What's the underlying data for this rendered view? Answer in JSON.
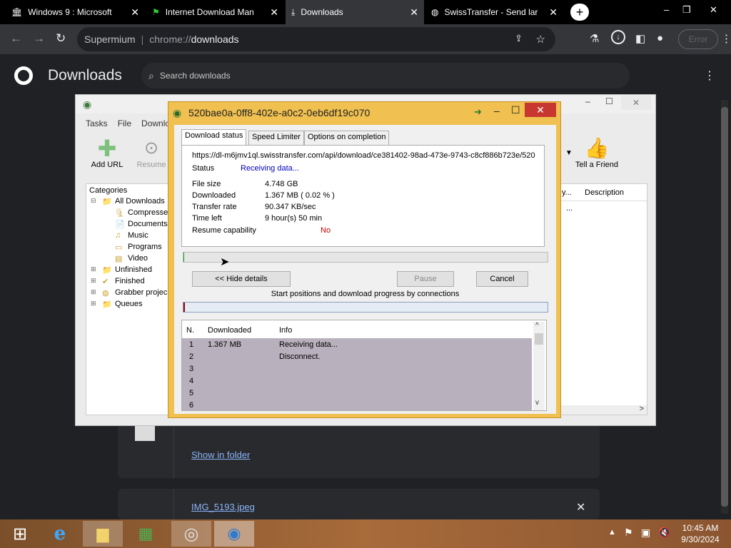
{
  "browser": {
    "tabs": [
      {
        "title": "Windows 9 : Microsoft",
        "icon": "library-icon",
        "active": false
      },
      {
        "title": "Internet Download Man",
        "icon": "flag-icon",
        "active": false
      },
      {
        "title": "Downloads",
        "icon": "download-icon",
        "active": true
      },
      {
        "title": "SwissTransfer - Send lar",
        "icon": "globe-icon",
        "active": false
      }
    ],
    "omnibox": {
      "site": "Supermium",
      "separator": "|",
      "prefix": "chrome://",
      "path": "downloads"
    },
    "error_label": "Error"
  },
  "downloads_page": {
    "title": "Downloads",
    "search_placeholder": "Search downloads",
    "show_in_folder": "Show in folder",
    "next_file": "IMG_5193.jpeg"
  },
  "idm_main": {
    "menu": [
      "Tasks",
      "File",
      "Downlo"
    ],
    "toolbar": {
      "add_url": "Add URL",
      "resume": "Resume",
      "tell_friend": "Tell a Friend"
    },
    "list_headers": {
      "description": "Description",
      "partial": "y...",
      "ellipsis": "..."
    },
    "categories_label": "Categories",
    "tree": [
      {
        "label": "All Downloads",
        "level": 0
      },
      {
        "label": "Compresse",
        "level": 1
      },
      {
        "label": "Documents",
        "level": 1
      },
      {
        "label": "Music",
        "level": 1
      },
      {
        "label": "Programs",
        "level": 1
      },
      {
        "label": "Video",
        "level": 1
      },
      {
        "label": "Unfinished",
        "level": 0
      },
      {
        "label": "Finished",
        "level": 0
      },
      {
        "label": "Grabber projec",
        "level": 0
      },
      {
        "label": "Queues",
        "level": 0
      }
    ]
  },
  "dialog": {
    "title": "520bae0a-0ff8-402e-a0c2-0eb6df19c070",
    "tabs": [
      "Download status",
      "Speed Limiter",
      "Options on completion"
    ],
    "url": "https://dl-m6jmv1ql.swisstransfer.com/api/download/ce381402-98ad-473e-9743-c8cf886b723e/520",
    "status_label": "Status",
    "status_value": "Receiving data...",
    "fields": [
      {
        "label": "File size",
        "value": "4.748  GB"
      },
      {
        "label": "Downloaded",
        "value": "1.367  MB  ( 0.02 % )"
      },
      {
        "label": "Transfer rate",
        "value": "90.347  KB/sec"
      },
      {
        "label": "Time left",
        "value": "9 hour(s) 50 min"
      }
    ],
    "resume_label": "Resume capability",
    "resume_value": "No",
    "progress_fraction": 0.0002,
    "buttons": {
      "hide_details": "<< Hide details",
      "pause": "Pause",
      "cancel": "Cancel"
    },
    "connections_caption": "Start positions and download progress by connections",
    "conn_headers": {
      "n": "N.",
      "downloaded": "Downloaded",
      "info": "Info"
    },
    "connections": [
      {
        "n": "1",
        "downloaded": "1.367  MB",
        "info": "Receiving data..."
      },
      {
        "n": "2",
        "downloaded": "",
        "info": "Disconnect."
      },
      {
        "n": "3",
        "downloaded": "",
        "info": ""
      },
      {
        "n": "4",
        "downloaded": "",
        "info": ""
      },
      {
        "n": "5",
        "downloaded": "",
        "info": ""
      },
      {
        "n": "6",
        "downloaded": "",
        "info": ""
      }
    ]
  },
  "taskbar": {
    "time": "10:45 AM",
    "date": "9/30/2024"
  },
  "colors": {
    "accent_blue": "#8ab4f8",
    "dialog_border": "#f0c050",
    "status_blue": "#0000c0",
    "no_red": "#c00000"
  }
}
